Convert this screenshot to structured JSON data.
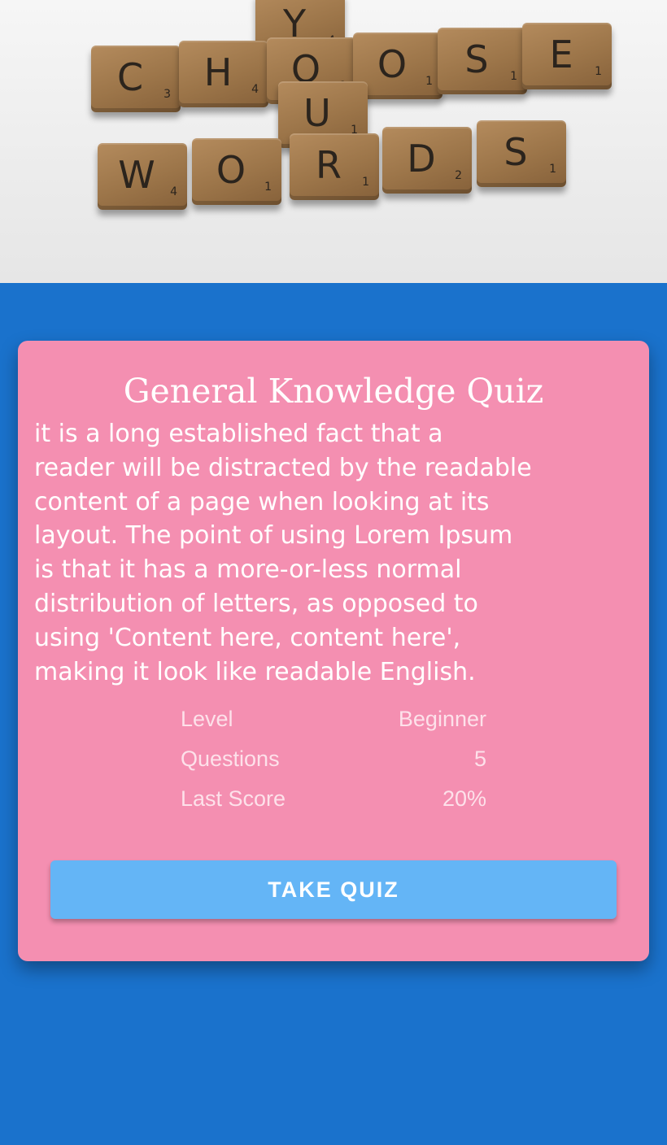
{
  "hero": {
    "image_alt": "Scrabble tiles spelling CHOOSE YOUR WORDS",
    "tiles": [
      {
        "letter": "Y",
        "points": "4"
      },
      {
        "letter": "C",
        "points": "3"
      },
      {
        "letter": "H",
        "points": "4"
      },
      {
        "letter": "O",
        "points": "1"
      },
      {
        "letter": "O",
        "points": "1"
      },
      {
        "letter": "S",
        "points": "1"
      },
      {
        "letter": "E",
        "points": "1"
      },
      {
        "letter": "U",
        "points": "1"
      },
      {
        "letter": "W",
        "points": "4"
      },
      {
        "letter": "O",
        "points": "1"
      },
      {
        "letter": "R",
        "points": "1"
      },
      {
        "letter": "D",
        "points": "2"
      },
      {
        "letter": "S",
        "points": "1"
      }
    ]
  },
  "quiz": {
    "title": "General Knowledge Quiz",
    "description": "it is a long established fact that a\nreader will be distracted by the readable\ncontent of a page when looking at its\nlayout. The point of using Lorem Ipsum\nis that it has a more-or-less normal\ndistribution of letters, as opposed to\nusing 'Content here, content here',\nmaking it look like readable English.",
    "stats": [
      {
        "label": "Level",
        "value": "Beginner"
      },
      {
        "label": "Questions",
        "value": "5"
      },
      {
        "label": "Last Score",
        "value": "20%"
      }
    ],
    "button_label": "TAKE QUIZ"
  },
  "colors": {
    "background": "#1a72cc",
    "card": "#f48fb1",
    "button": "#64b5f6",
    "tile_wood": "#9c7549"
  }
}
